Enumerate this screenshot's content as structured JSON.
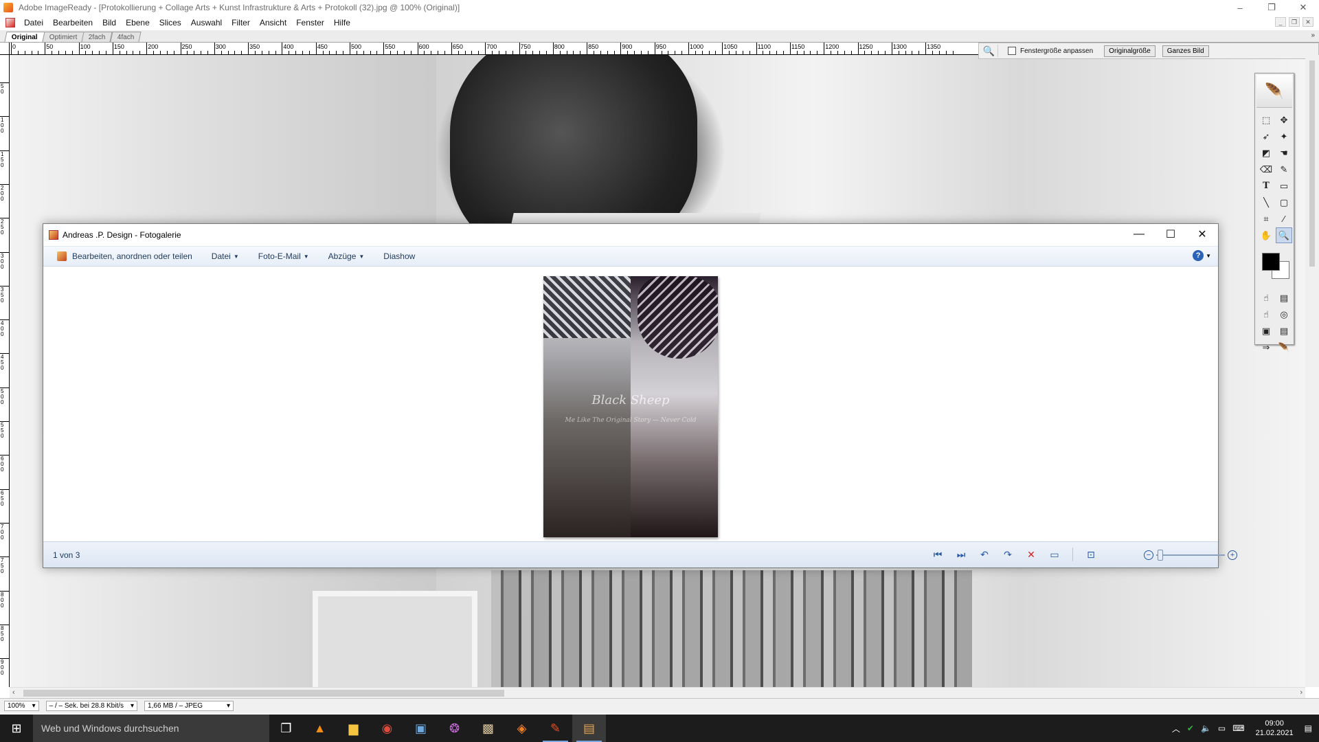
{
  "app": {
    "title": "Adobe ImageReady - [Protokollierung + Collage Arts + Kunst Infrastrukture & Arts + Protokoll (32).jpg @ 100% (Original)]",
    "window_controls": [
      "–",
      "❐",
      "✕"
    ]
  },
  "menubar": {
    "items": [
      "Datei",
      "Bearbeiten",
      "Bild",
      "Ebene",
      "Slices",
      "Auswahl",
      "Filter",
      "Ansicht",
      "Fenster",
      "Hilfe"
    ]
  },
  "doc_tabs": [
    "Original",
    "Optimiert",
    "2fach",
    "4fach"
  ],
  "ruler": {
    "top_labels": [
      "0",
      "50",
      "100",
      "150",
      "200",
      "250",
      "300",
      "350",
      "400",
      "450",
      "500",
      "550",
      "600",
      "650",
      "700",
      "750",
      "800",
      "850",
      "900",
      "950",
      "1000",
      "1050",
      "1100",
      "1150",
      "1200",
      "1250",
      "1300",
      "1350"
    ],
    "left_labels": [
      "50",
      "100",
      "150",
      "200",
      "250",
      "300",
      "350",
      "400",
      "450",
      "500",
      "550",
      "600",
      "650",
      "700",
      "750",
      "800",
      "850",
      "900"
    ]
  },
  "options_bar": {
    "checkbox_label": "Fenstergröße anpassen",
    "btn_original": "Originalgröße",
    "btn_fit": "Ganzes Bild"
  },
  "statusbar": {
    "zoom": "100%",
    "speed": "– / – Sek. bei 28.8 Kbit/s",
    "size": "1,66 MB / – JPEG"
  },
  "gallery": {
    "title": "Andreas .P. Design - Fotogalerie",
    "window_controls": [
      "—",
      "☐",
      "✕"
    ],
    "commands": {
      "edit": "Bearbeiten, anordnen oder teilen",
      "file": "Datei",
      "email": "Foto-E-Mail",
      "prints": "Abzüge",
      "slideshow": "Diashow"
    },
    "photo_caption": "Black Sheep",
    "photo_subcaption": "Me Like The Original Story — Never Cold",
    "counter": "1 von 3"
  },
  "taskbar": {
    "search_placeholder": "Web und Windows durchsuchen",
    "time": "09:00",
    "date": "21.02.2021"
  }
}
